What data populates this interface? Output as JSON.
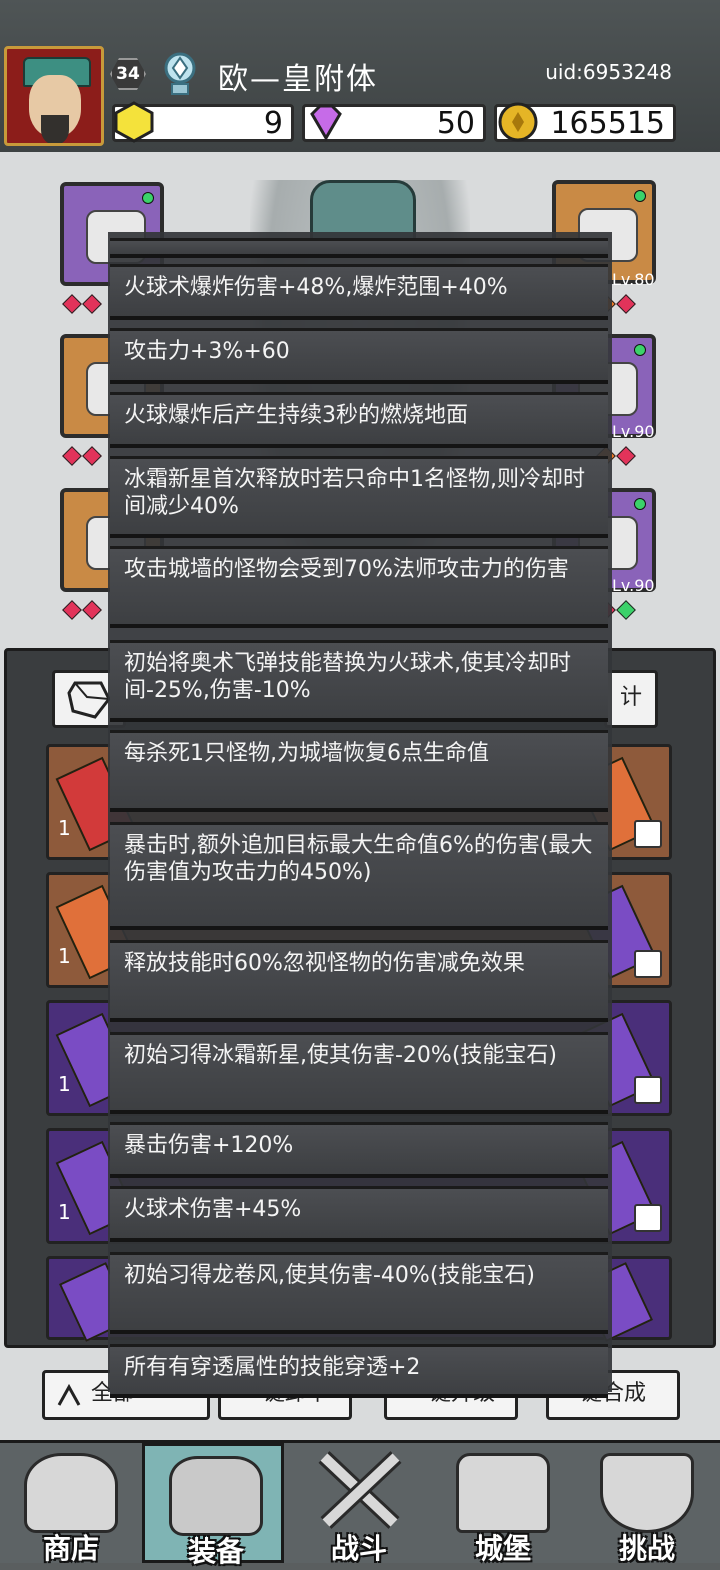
{
  "header": {
    "level": "34",
    "player_name": "欧—皇附体",
    "uid": "uid:6953248",
    "resources": [
      {
        "name": "gold-gem",
        "value": "9",
        "color": "#f4e23b"
      },
      {
        "name": "diamond",
        "value": "50",
        "color": "#c66be8"
      },
      {
        "name": "coin",
        "value": "165515",
        "color": "#e5b526"
      }
    ]
  },
  "equipment": {
    "slot_levels": [
      "Lv.80",
      "Lv.90",
      "Lv.90"
    ]
  },
  "inventory": {
    "tab_partial": "计",
    "row_count_prefix": "1",
    "bottom_buttons": {
      "all_label": "全部",
      "b2_label": "一键卸下",
      "b3_label": "一键升级",
      "b4_label": "键合成"
    }
  },
  "tooltip": {
    "lines": [
      "火球术爆炸伤害+48%,爆炸范围+40%",
      "攻击力+3%+60",
      "火球爆炸后产生持续3秒的燃烧地面",
      "冰霜新星首次释放时若只命中1名怪物,则冷却时间减少40%",
      "攻击城墙的怪物会受到70%法师攻击力的伤害",
      "初始将奥术飞弹技能替换为火球术,使其冷却时间-25%,伤害-10%",
      "每杀死1只怪物,为城墙恢复6点生命值",
      "暴击时,额外追加目标最大生命值6%的伤害(最大伤害值为攻击力的450%)",
      "释放技能时60%忽视怪物的伤害减免效果",
      "初始习得冰霜新星,使其伤害-20%(技能宝石)",
      "暴击伤害+120%",
      "火球术伤害+45%",
      "初始习得龙卷风,使其伤害-40%(技能宝石)",
      "所有有穿透属性的技能穿透+2"
    ]
  },
  "nav": {
    "items": [
      {
        "label": "商店",
        "icon": "shop-icon"
      },
      {
        "label": "装备",
        "icon": "backpack-icon"
      },
      {
        "label": "战斗",
        "icon": "swords-icon"
      },
      {
        "label": "城堡",
        "icon": "castle-icon"
      },
      {
        "label": "挑战",
        "icon": "shield-icon"
      }
    ],
    "active_index": 1
  }
}
